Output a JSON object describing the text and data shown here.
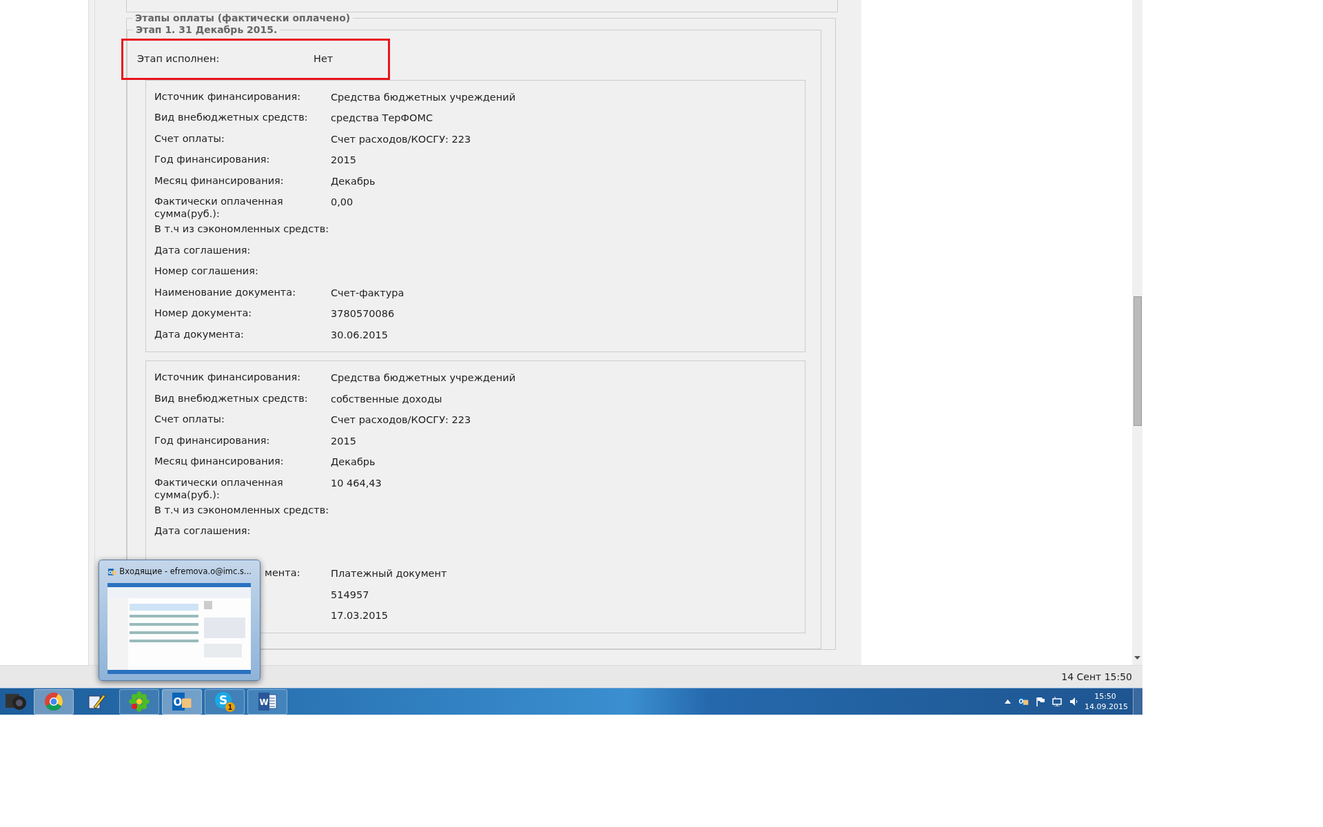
{
  "page": {
    "section_title": "Этапы оплаты (фактически оплачено)",
    "stage": {
      "title": "Этап 1. 31 Декабрь 2015.",
      "completed_label": "Этап исполнен:",
      "completed_value": "Нет",
      "highlighted": true,
      "sources": [
        {
          "rows": [
            {
              "kind": "field",
              "label": "Источник финансирования:",
              "value": "Средства бюджетных учреждений"
            },
            {
              "kind": "field",
              "label": "Вид внебюджетных средств:",
              "value": "средства ТерФОМС"
            },
            {
              "kind": "field",
              "label": "Счет оплаты:",
              "value": "Счет расходов/КОСГУ: 223"
            },
            {
              "kind": "field",
              "label": "Год финансирования:",
              "value": "2015"
            },
            {
              "kind": "field",
              "label": "Месяц финансирования:",
              "value": "Декабрь"
            },
            {
              "kind": "field",
              "label": "Фактически оплаченная сумма(руб.):",
              "value": "0,00"
            },
            {
              "kind": "field",
              "label": "В т.ч из сэкономленных средств:"
            },
            {
              "kind": "field",
              "label": "Дата соглашения:"
            },
            {
              "kind": "field",
              "label": "Номер соглашения:"
            },
            {
              "kind": "field",
              "label": "Наименование документа:",
              "value": "Счет-фактура"
            },
            {
              "kind": "field",
              "label": "Номер документа:",
              "value": "3780570086"
            },
            {
              "kind": "field",
              "label": "Дата документа:",
              "value": "30.06.2015"
            }
          ]
        },
        {
          "rows": [
            {
              "kind": "field",
              "label": "Источник финансирования:",
              "value": "Средства бюджетных учреждений"
            },
            {
              "kind": "field",
              "label": "Вид внебюджетных средств:",
              "value": "собственные доходы"
            },
            {
              "kind": "field",
              "label": "Счет оплаты:",
              "value": "Счет расходов/КОСГУ: 223"
            },
            {
              "kind": "field",
              "label": "Год финансирования:",
              "value": "2015"
            },
            {
              "kind": "field",
              "label": "Месяц финансирования:",
              "value": "Декабрь"
            },
            {
              "kind": "field",
              "label": "Фактически оплаченная сумма(руб.):",
              "value": "10 464,43"
            },
            {
              "kind": "field",
              "label": "В т.ч из сэкономленных средств:"
            },
            {
              "kind": "field",
              "label": "Дата соглашения:"
            },
            {
              "kind": "covered"
            },
            {
              "kind": "partial",
              "label": "мента:",
              "value": "Платежный документ"
            },
            {
              "kind": "covered",
              "value": "514957"
            },
            {
              "kind": "covered",
              "value": "17.03.2015"
            }
          ]
        }
      ]
    }
  },
  "status_bar": {
    "datetime": "14 Сент 15:50"
  },
  "taskbar": {
    "apps": [
      {
        "kind": "camera",
        "running": false,
        "selected": false
      },
      {
        "kind": "chrome",
        "running": true,
        "selected": true
      },
      {
        "kind": "pencil",
        "running": false,
        "selected": false
      },
      {
        "kind": "flower",
        "running": true,
        "selected": false
      },
      {
        "kind": "mail",
        "running": true,
        "selected": true,
        "glyph": "O"
      },
      {
        "kind": "skype",
        "running": true,
        "selected": false,
        "glyph": "S",
        "badge": "1"
      },
      {
        "kind": "word",
        "running": true,
        "selected": false,
        "glyph": "W"
      }
    ],
    "tray": {
      "time": "15:50",
      "date": "14.09.2015",
      "mail_glyph": "O"
    }
  },
  "thumbnail": {
    "title": "Входящие - efremova.o@imc.s...",
    "glyph": "O"
  }
}
